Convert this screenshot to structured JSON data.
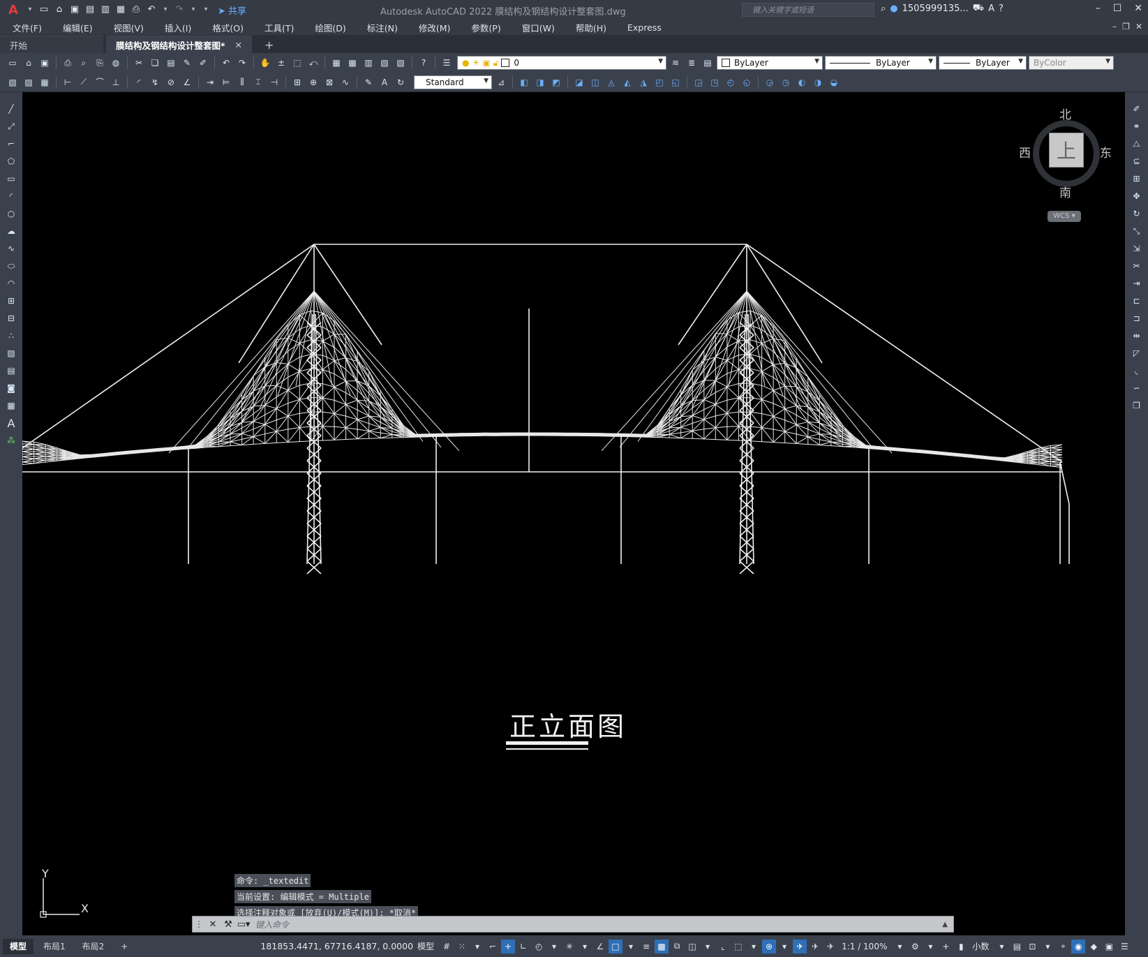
{
  "app": {
    "title": "Autodesk AutoCAD 2022    膜结构及钢结构设计整套图.dwg",
    "logo": "A",
    "share_label": "共享",
    "search_placeholder": "键入关键字或短语",
    "user": "1505999135...",
    "window_controls": [
      "–",
      "☐",
      "✕"
    ]
  },
  "menu": [
    "文件(F)",
    "编辑(E)",
    "视图(V)",
    "插入(I)",
    "格式(O)",
    "工具(T)",
    "绘图(D)",
    "标注(N)",
    "修改(M)",
    "参数(P)",
    "窗口(W)",
    "帮助(H)",
    "Express"
  ],
  "tabs": [
    {
      "label": "开始",
      "active": false
    },
    {
      "label": "膜结构及钢结构设计整套图*",
      "active": true
    }
  ],
  "tab_close": "✕",
  "tab_add": "+",
  "toolbar": {
    "layer": "0",
    "color": "ByLayer",
    "linetype": "ByLayer",
    "lineweight": "ByLayer",
    "plotstyle": "ByColor",
    "text_style": "Standard"
  },
  "viewcube": {
    "north": "北",
    "south": "南",
    "west": "西",
    "east": "东",
    "face": "上",
    "wcs": "WCS"
  },
  "drawing": {
    "title": "正立面图"
  },
  "ucs": {
    "x": "X",
    "y": "Y"
  },
  "command": {
    "history": [
      "命令: _textedit",
      "当前设置: 编辑模式 = Multiple",
      "选择注释对象或 [放弃(U)/模式(M)]: *取消*"
    ],
    "placeholder": "键入命令"
  },
  "layout_tabs": [
    {
      "label": "模型",
      "active": true
    },
    {
      "label": "布局1",
      "active": false
    },
    {
      "label": "布局2",
      "active": false
    }
  ],
  "layout_add": "+",
  "status": {
    "coords": "181853.4471, 67716.4187, 0.0000",
    "space": "模型",
    "scale": "1:1 / 100%",
    "units": "小数"
  }
}
